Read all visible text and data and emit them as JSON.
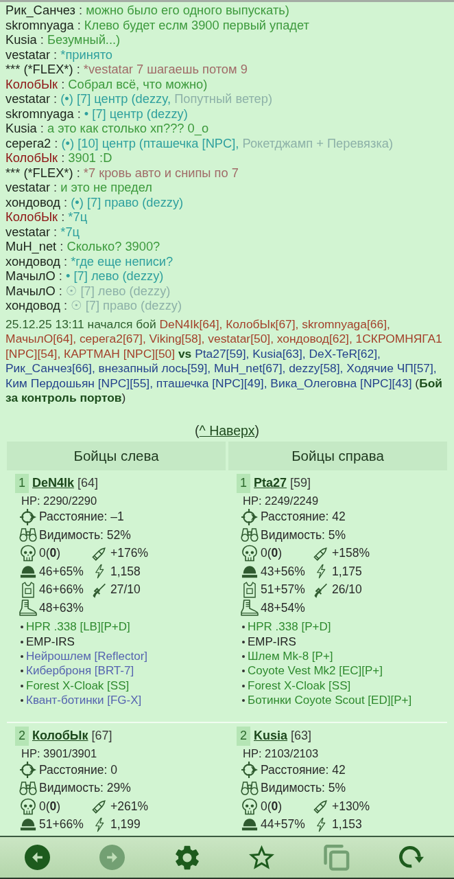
{
  "chat": [
    {
      "author": "Рик_Санчез",
      "author_highlight": false,
      "parts": [
        {
          "kind": "plain",
          "text": " : "
        },
        {
          "kind": "say",
          "text": "можно было его одного выпускать)"
        }
      ]
    },
    {
      "author": "skromnyaga",
      "author_highlight": false,
      "parts": [
        {
          "kind": "plain",
          "text": " : "
        },
        {
          "kind": "say",
          "text": "Клево будет еслм 3900 первый упадет"
        }
      ]
    },
    {
      "author": "Kusia",
      "author_highlight": false,
      "parts": [
        {
          "kind": "plain",
          "text": " : "
        },
        {
          "kind": "say",
          "text": "Безумный...)"
        }
      ]
    },
    {
      "author": "vestatar",
      "author_highlight": false,
      "parts": [
        {
          "kind": "plain",
          "text": " : "
        },
        {
          "kind": "team",
          "text": "*принято"
        }
      ]
    },
    {
      "author": "*** (*FLEX*)",
      "author_highlight": false,
      "parts": [
        {
          "kind": "plain",
          "text": " : "
        },
        {
          "kind": "flex",
          "text": "*vestatar 7 шагаешь потом 9"
        }
      ]
    },
    {
      "author": "КолобЫк",
      "author_highlight": true,
      "parts": [
        {
          "kind": "plain",
          "text": " : "
        },
        {
          "kind": "say",
          "text": "Собрал всё, что можно)"
        }
      ]
    },
    {
      "author": "vestatar",
      "author_highlight": false,
      "parts": [
        {
          "kind": "plain",
          "text": " : "
        },
        {
          "kind": "team",
          "text": "(•) [7] центр (dezzy, "
        },
        {
          "kind": "muted",
          "text": "Попутный ветер)"
        }
      ]
    },
    {
      "author": "skromnyaga",
      "author_highlight": false,
      "parts": [
        {
          "kind": "plain",
          "text": " : "
        },
        {
          "kind": "team",
          "text": "• [7] центр (dezzy)"
        }
      ]
    },
    {
      "author": "Kusia",
      "author_highlight": false,
      "parts": [
        {
          "kind": "plain",
          "text": " : "
        },
        {
          "kind": "say",
          "text": "а это как столько хп??? 0_о"
        }
      ]
    },
    {
      "author": "серега2",
      "author_highlight": false,
      "parts": [
        {
          "kind": "plain",
          "text": " : "
        },
        {
          "kind": "team",
          "text": "(•) [10] центр (пташечка [NPC], "
        },
        {
          "kind": "muted",
          "text": "Рокетджамп + Перевязка)"
        }
      ]
    },
    {
      "author": "КолобЫк",
      "author_highlight": true,
      "parts": [
        {
          "kind": "plain",
          "text": " : "
        },
        {
          "kind": "say",
          "text": "3901 :D"
        }
      ]
    },
    {
      "author": "*** (*FLEX*)",
      "author_highlight": false,
      "parts": [
        {
          "kind": "plain",
          "text": " : "
        },
        {
          "kind": "flex",
          "text": "*7 кровь авто и снипы по 7"
        }
      ]
    },
    {
      "author": "vestatar",
      "author_highlight": false,
      "parts": [
        {
          "kind": "plain",
          "text": " : "
        },
        {
          "kind": "say",
          "text": "и это не предел"
        }
      ]
    },
    {
      "author": "хондовод",
      "author_highlight": false,
      "parts": [
        {
          "kind": "plain",
          "text": " : "
        },
        {
          "kind": "team",
          "text": "(•) [7] право (dezzy)"
        }
      ]
    },
    {
      "author": "КолобЫк",
      "author_highlight": true,
      "parts": [
        {
          "kind": "plain",
          "text": " : "
        },
        {
          "kind": "team",
          "text": "*7ц"
        }
      ]
    },
    {
      "author": "vestatar",
      "author_highlight": false,
      "parts": [
        {
          "kind": "plain",
          "text": " : "
        },
        {
          "kind": "team",
          "text": "*7ц"
        }
      ]
    },
    {
      "author": "MuH_net",
      "author_highlight": false,
      "parts": [
        {
          "kind": "plain",
          "text": " : "
        },
        {
          "kind": "say",
          "text": "Сколько? 3900?"
        }
      ]
    },
    {
      "author": "хондовод",
      "author_highlight": false,
      "parts": [
        {
          "kind": "plain",
          "text": " : "
        },
        {
          "kind": "team",
          "text": "*где еще неписи?"
        }
      ]
    },
    {
      "author": "МачылО",
      "author_highlight": false,
      "parts": [
        {
          "kind": "plain",
          "text": " : "
        },
        {
          "kind": "team",
          "text": "• [7] лево (dezzy)"
        }
      ]
    },
    {
      "author": "МачылО",
      "author_highlight": false,
      "parts": [
        {
          "kind": "plain",
          "text": " : "
        },
        {
          "kind": "muted",
          "text": "☉ [7] лево (dezzy)"
        }
      ]
    },
    {
      "author": "хондовод",
      "author_highlight": false,
      "parts": [
        {
          "kind": "plain",
          "text": " : "
        },
        {
          "kind": "muted",
          "text": "☉ [7] право (dezzy)"
        }
      ]
    }
  ],
  "battle_log": {
    "started": "25.12.25 13:11 начался бой",
    "left_team": "DeN4Ik[64], КолобЫк[67], skromnyaga[66], МачылО[64], серега2[67], Viking[58], vestatar[50], хондовод[62], 1СКРОМНЯГА1 [NPC][54], КАРТМАН [NPC][50]",
    "versus": "vs",
    "right_team": "Pta27[59], Kusia[63], DeX-TeR[62], Рик_Санчез[66], внезапный лось[59], MuH_net[67], dezzy[58], Ходячие ЧП[57], Ким Пердошьян [NPC][55], пташечка [NPC][49], Вика_Олеговна [NPC][43]",
    "battle_name": "(**Бой за контроль портов**)"
  },
  "top_link": {
    "prefix": "(",
    "label": "^ Наверх",
    "suffix": ")"
  },
  "fighters_table": {
    "columns": [
      "Бойцы слева",
      "Бойцы справа"
    ],
    "rows": [
      {
        "left": {
          "number": "1",
          "name": "DeN4Ik",
          "rank": "[64]",
          "hp": "HP: 2290/2290",
          "stats": [
            {
              "kind": "distance",
              "text": "Расстояние: –1"
            },
            {
              "kind": "visibility",
              "text": "Видимость: 52%"
            },
            {
              "kind": "kills",
              "text": "0(**0**)"
            },
            {
              "kind": "damage",
              "text": "+176%"
            },
            {
              "kind": "helmet",
              "text": "46+65%"
            },
            {
              "kind": "speed",
              "text": "1,158"
            },
            {
              "kind": "armor",
              "text": "46+66%"
            },
            {
              "kind": "weapon",
              "text": "27/10"
            },
            {
              "kind": "boots",
              "text": "48+63%"
            }
          ],
          "items": [
            {
              "text": "HPR .338 [LB][P+D]",
              "color": "#2e8a2e"
            },
            {
              "text": "EMP-IRS",
              "color": "#222222"
            },
            {
              "text": "Нейрошлем [Reflector]",
              "color": "#5563b0"
            },
            {
              "text": "Киберброня [BRT-7]",
              "color": "#5563b0"
            },
            {
              "text": "Forest X-Cloak [SS]",
              "color": "#2e8a2e"
            },
            {
              "text": "Квант-ботинки [FG-X]",
              "color": "#5563b0"
            }
          ]
        },
        "right": {
          "number": "1",
          "name": "Pta27",
          "rank": "[59]",
          "hp": "HP: 2249/2249",
          "stats": [
            {
              "kind": "distance",
              "text": "Расстояние: 42"
            },
            {
              "kind": "visibility",
              "text": "Видимость: 5%"
            },
            {
              "kind": "kills",
              "text": "0(**0**)"
            },
            {
              "kind": "damage",
              "text": "+158%"
            },
            {
              "kind": "helmet",
              "text": "43+56%"
            },
            {
              "kind": "speed",
              "text": "1,175"
            },
            {
              "kind": "armor",
              "text": "51+57%"
            },
            {
              "kind": "weapon",
              "text": "26/10"
            },
            {
              "kind": "boots",
              "text": "48+54%"
            }
          ],
          "items": [
            {
              "text": "HPR .338 [P+D]",
              "color": "#2e8a2e"
            },
            {
              "text": "EMP-IRS",
              "color": "#222222"
            },
            {
              "text": "Шлем Mk-8 [P+]",
              "color": "#2e8a2e"
            },
            {
              "text": "Coyote Vest Mk2 [EC][P+]",
              "color": "#2e8a2e"
            },
            {
              "text": "Forest X-Cloak [SS]",
              "color": "#2e8a2e"
            },
            {
              "text": "Ботинки Coyote Scout [ED][P+]",
              "color": "#2e8a2e"
            }
          ]
        }
      },
      {
        "left": {
          "number": "2",
          "name": "КолобЫк",
          "rank": "[67]",
          "hp": "HP: 3901/3901",
          "stats": [
            {
              "kind": "distance",
              "text": "Расстояние: 0"
            },
            {
              "kind": "visibility",
              "text": "Видимость: 29%"
            },
            {
              "kind": "kills",
              "text": "0(**0**)"
            },
            {
              "kind": "damage",
              "text": "+261%"
            },
            {
              "kind": "helmet",
              "text": "51+66%"
            },
            {
              "kind": "speed",
              "text": "1,199"
            }
          ]
        },
        "right": {
          "number": "2",
          "name": "Kusia",
          "rank": "[63]",
          "hp": "HP: 2103/2103",
          "stats": [
            {
              "kind": "distance",
              "text": "Расстояние: 42"
            },
            {
              "kind": "visibility",
              "text": "Видимость: 5%"
            },
            {
              "kind": "kills",
              "text": "0(**0**)"
            },
            {
              "kind": "damage",
              "text": "+130%"
            },
            {
              "kind": "helmet",
              "text": "44+57%"
            },
            {
              "kind": "speed",
              "text": "1,153"
            }
          ]
        }
      }
    ]
  },
  "toolbar": [
    {
      "kind": "back",
      "disabled": false
    },
    {
      "kind": "forward",
      "disabled": true
    },
    {
      "kind": "settings",
      "disabled": false
    },
    {
      "kind": "star",
      "disabled": false
    },
    {
      "kind": "copy",
      "disabled": true
    },
    {
      "kind": "refresh",
      "disabled": false
    }
  ]
}
